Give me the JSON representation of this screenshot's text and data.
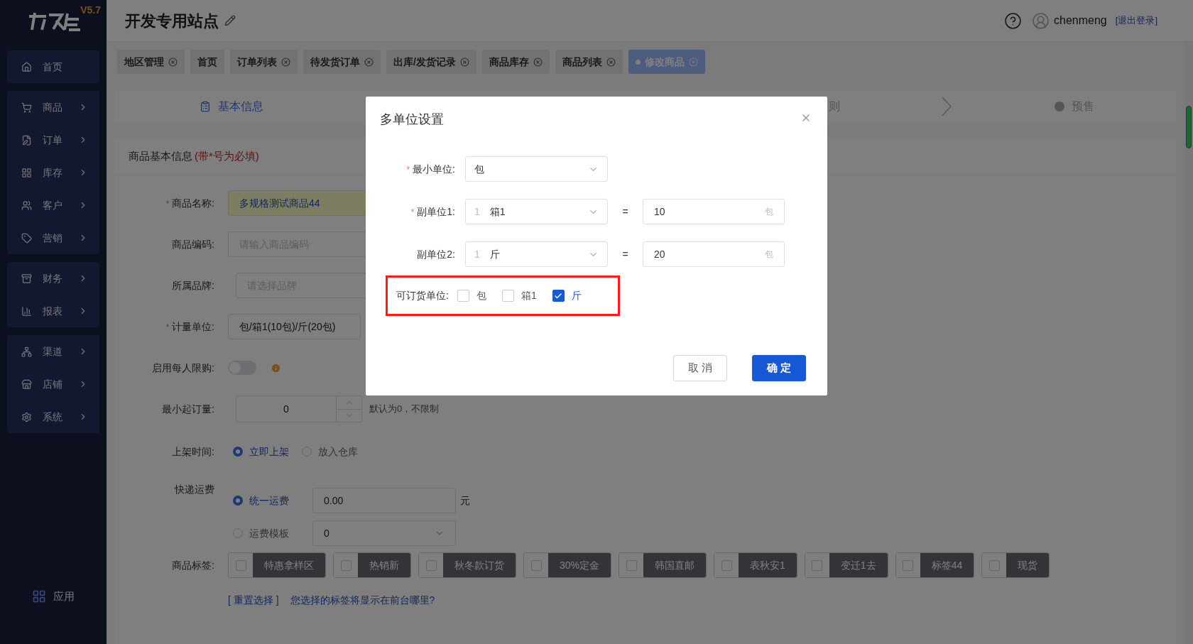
{
  "logo": {
    "version": "V5.7"
  },
  "sidebar": {
    "groups": [
      {
        "items": [
          {
            "label": "首页",
            "arrow": false
          }
        ]
      },
      {
        "items": [
          {
            "label": "商品",
            "arrow": true
          },
          {
            "label": "订单",
            "arrow": true
          },
          {
            "label": "库存",
            "arrow": true
          },
          {
            "label": "客户",
            "arrow": true
          },
          {
            "label": "营销",
            "arrow": true
          }
        ]
      },
      {
        "items": [
          {
            "label": "财务",
            "arrow": true
          },
          {
            "label": "报表",
            "arrow": true
          }
        ]
      },
      {
        "items": [
          {
            "label": "渠道",
            "arrow": true
          },
          {
            "label": "店铺",
            "arrow": true
          },
          {
            "label": "系统",
            "arrow": true
          }
        ]
      }
    ],
    "footer": {
      "label": "应用"
    }
  },
  "header": {
    "title": "开发专用站点",
    "user": "chenmeng",
    "logout": "[退出登录]"
  },
  "tabs": [
    {
      "label": "地区管理",
      "selected": false,
      "closable": true
    },
    {
      "label": "首页",
      "selected": false,
      "closable": false
    },
    {
      "label": "订单列表",
      "selected": false,
      "closable": true
    },
    {
      "label": "待发货订单",
      "selected": false,
      "closable": true
    },
    {
      "label": "出库/发货记录",
      "selected": false,
      "closable": true
    },
    {
      "label": "商品库存",
      "selected": false,
      "closable": true
    },
    {
      "label": "商品列表",
      "selected": false,
      "closable": true
    },
    {
      "label": "修改商品",
      "selected": true,
      "closable": true
    }
  ],
  "steps": [
    {
      "label": "基本信息",
      "selected": true
    },
    {
      "label": "则",
      "selected": false
    },
    {
      "label": "预售",
      "selected": false
    }
  ],
  "form": {
    "title": "商品基本信息",
    "title_note": "(带*号为必填)",
    "rows": [
      {
        "kind": "text",
        "label": "商品名称:",
        "required_mark": "*",
        "value": "多规格测试商品44",
        "autofilled": true
      },
      {
        "kind": "text",
        "label": "商品编码:",
        "placeholder": "请输入商品编码"
      },
      {
        "kind": "select",
        "label": "所属品牌:",
        "placeholder": "请选择品牌"
      },
      {
        "kind": "unit",
        "label": "计量单位:",
        "required_mark": "*",
        "value": "包/箱1(10包)/斤(20包)"
      },
      {
        "kind": "toggle",
        "label": "启用每人限购:",
        "on": false
      },
      {
        "kind": "number",
        "label": "最小起订量:",
        "value": "0",
        "hint": "默认为0，不限制"
      },
      {
        "kind": "radio",
        "label": "上架时间:",
        "options": [
          {
            "label": "立即上架",
            "selected": true
          },
          {
            "label": "放入仓库",
            "selected": false
          }
        ]
      },
      {
        "kind": "freight",
        "label": "快递运费",
        "options": [
          {
            "label": "统一运费",
            "selected": true,
            "value": "0.00",
            "suffix": "元"
          },
          {
            "label": "运费模板",
            "selected": false,
            "value": "0"
          }
        ]
      },
      {
        "kind": "tags",
        "label": "商品标签:",
        "tags": [
          {
            "label": "特惠拿样区",
            "checked": false
          },
          {
            "label": "热销新",
            "checked": false
          },
          {
            "label": "秋冬款订货",
            "checked": false
          },
          {
            "label": "30%定金",
            "checked": false
          },
          {
            "label": "韩国直邮",
            "checked": false
          },
          {
            "label": "表秋安1",
            "checked": false
          },
          {
            "label": "变迁1去",
            "checked": false
          },
          {
            "label": "标签44",
            "checked": false
          },
          {
            "label": "现货",
            "checked": false
          }
        ]
      },
      {
        "kind": "links",
        "links": [
          "[ 重置选择 ]",
          "您选择的标签将显示在前台哪里?"
        ]
      }
    ]
  },
  "modal": {
    "title": "多单位设置",
    "rows": [
      {
        "label": "最小单位:",
        "required_mark": "*",
        "select": "包"
      },
      {
        "label": "副单位1:",
        "required_mark": "*",
        "count": "1",
        "select": "箱1",
        "equals": "=",
        "value": "10",
        "unit": "包"
      },
      {
        "label": "副单位2:",
        "count": "1",
        "select": "斤",
        "equals": "=",
        "value": "20",
        "unit": "包"
      }
    ],
    "orderable": {
      "label": "可订货单位:",
      "highlighted": true,
      "options": [
        {
          "label": "包",
          "checked": false
        },
        {
          "label": "箱1",
          "checked": false
        },
        {
          "label": "斤",
          "checked": true
        }
      ]
    },
    "buttons": [
      {
        "label": "取 消",
        "kind": "secondary"
      },
      {
        "label": "确 定",
        "kind": "primary"
      }
    ]
  }
}
